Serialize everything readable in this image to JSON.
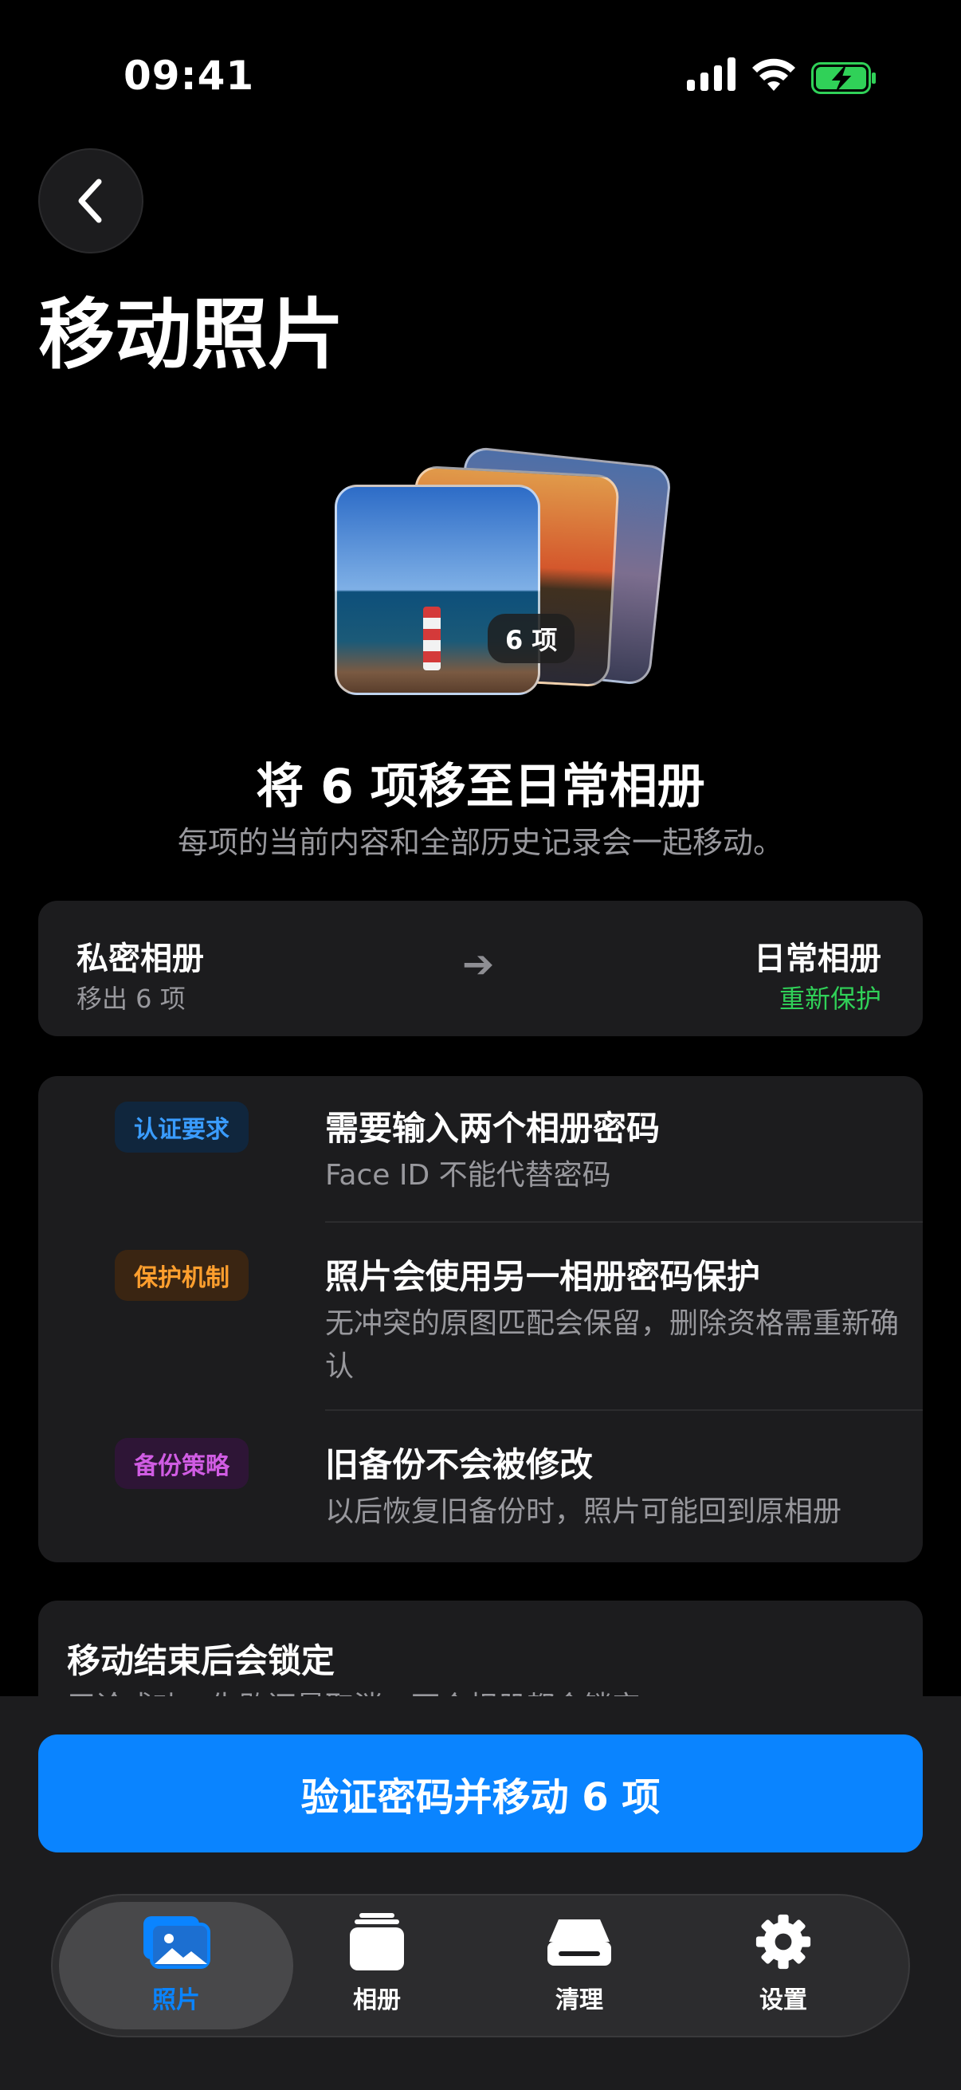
{
  "status_bar": {
    "time": "09:41"
  },
  "header": {
    "title": "移动照片"
  },
  "hero": {
    "count_badge": "6 项",
    "headline": "将 6 项移至日常相册",
    "subtitle": "每项的当前内容和全部历史记录会一起移动。"
  },
  "route": {
    "from_title": "私密相册",
    "from_sub": "移出 6 项",
    "to_title": "日常相册",
    "to_sub": "重新保护"
  },
  "info": [
    {
      "tag": "认证要求",
      "title": "需要输入两个相册密码",
      "desc": "Face ID 不能代替密码"
    },
    {
      "tag": "保护机制",
      "title": "照片会使用另一相册密码保护",
      "desc": "无冲突的原图匹配会保留，删除资格需重新确认"
    },
    {
      "tag": "备份策略",
      "title": "旧备份不会被修改",
      "desc": "以后恢复旧备份时，照片可能回到原相册"
    }
  ],
  "lock_card": {
    "title": "移动结束后会锁定",
    "desc": "无论成功、失败还是取消，两个相册都会锁定"
  },
  "cta": {
    "label": "验证密码并移动 6 项"
  },
  "tabs": [
    {
      "label": "照片",
      "icon": "photos-icon",
      "active": true
    },
    {
      "label": "相册",
      "icon": "albums-icon",
      "active": false
    },
    {
      "label": "清理",
      "icon": "storage-icon",
      "active": false
    },
    {
      "label": "设置",
      "icon": "gear-icon",
      "active": false
    }
  ],
  "colors": {
    "accent": "#0a84ff",
    "green": "#30d158",
    "tag_blue": "#3a9cff",
    "tag_orange": "#ff9f2e",
    "tag_purple": "#d05ce3"
  }
}
